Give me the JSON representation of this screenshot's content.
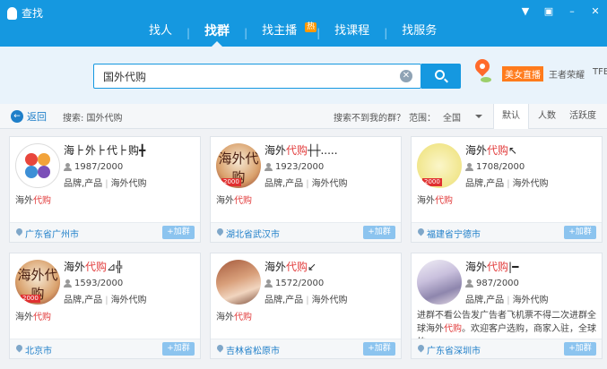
{
  "window": {
    "title": "查找",
    "controls": [
      "▼",
      "▣",
      "–",
      "✕"
    ]
  },
  "tabs": [
    {
      "label": "找人",
      "active": false
    },
    {
      "label": "找群",
      "active": true
    },
    {
      "label": "找主播",
      "active": false,
      "badge": "热"
    },
    {
      "label": "找课程",
      "active": false
    },
    {
      "label": "找服务",
      "active": false
    }
  ],
  "search": {
    "value": "国外代购",
    "placeholder": ""
  },
  "hot": {
    "tag": "美女直播",
    "links": [
      "王者荣耀",
      "TFB"
    ]
  },
  "filter": {
    "back_label": "返回",
    "crumb": "搜索: 国外代购",
    "nofind": "搜索不到我的群？",
    "range_label": "范围：",
    "range_value": "全国",
    "sorts": [
      {
        "label": "默认",
        "active": true
      },
      {
        "label": "人数",
        "active": false
      },
      {
        "label": "活跃度",
        "active": false
      }
    ]
  },
  "cards": [
    {
      "name_pre": "海⺊外⺊代⺊购",
      "name_hl": "",
      "name_post": "╋",
      "members": "1987/2000",
      "tag1": "品牌,产品",
      "tag2": "海外代购",
      "kw_pre": "海外",
      "kw_hl": "代购",
      "kw_post": "",
      "location": "广东省广州市",
      "join": "+加群",
      "avatar": "logo"
    },
    {
      "name_pre": "海外",
      "name_hl": "代购",
      "name_post": "┼┼.....",
      "members": "1923/2000",
      "tag1": "品牌,产品",
      "tag2": "海外代购",
      "kw_pre": "海外",
      "kw_hl": "代购",
      "kw_post": "",
      "location": "湖北省武汉市",
      "join": "+加群",
      "avatar": "calli",
      "badge": "2000",
      "avatar_text": "海外代购"
    },
    {
      "name_pre": "海外",
      "name_hl": "代购",
      "name_post": "↖",
      "members": "1708/2000",
      "tag1": "品牌,产品",
      "tag2": "海外代购",
      "kw_pre": "海外",
      "kw_hl": "代购",
      "kw_post": "",
      "location": "福建省宁德市",
      "join": "+加群",
      "avatar": "yellow",
      "badge": "2000"
    },
    {
      "name_pre": "海外",
      "name_hl": "代购",
      "name_post": "⊿╬",
      "members": "1593/2000",
      "tag1": "品牌,产品",
      "tag2": "海外代购",
      "kw_pre": "海外",
      "kw_hl": "代购",
      "kw_post": "",
      "location": "北京市",
      "join": "+加群",
      "avatar": "calli",
      "badge": "2000",
      "avatar_text": "海外代购"
    },
    {
      "name_pre": "海外",
      "name_hl": "代购",
      "name_post": "↙",
      "members": "1572/2000",
      "tag1": "品牌,产品",
      "tag2": "海外代购",
      "kw_pre": "海外",
      "kw_hl": "代购",
      "kw_post": "",
      "location": "吉林省松原市",
      "join": "+加群",
      "avatar": "girl"
    },
    {
      "name_pre": "海外",
      "name_hl": "代购",
      "name_post": "|━",
      "members": "987/2000",
      "tag1": "品牌,产品",
      "tag2": "海外代购",
      "desc_pre": "进群不看公告发广告者飞机票不得二次进群全球海外",
      "desc_hl": "代购",
      "desc_post": "。欢迎客户选购，商家入驻，全球的...",
      "location": "广东省深圳市",
      "join": "+加群",
      "avatar": "anime"
    }
  ]
}
